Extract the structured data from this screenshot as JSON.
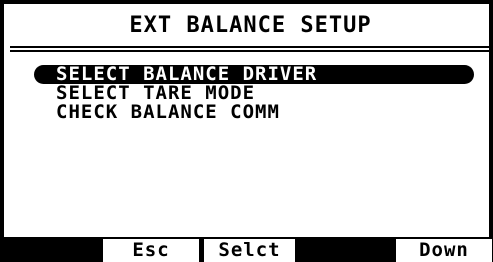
{
  "screen": {
    "title": "EXT BALANCE SETUP",
    "menu_items": [
      {
        "label": "SELECT BALANCE DRIVER",
        "selected": true
      },
      {
        "label": "SELECT TARE MODE",
        "selected": false
      },
      {
        "label": "CHECK BALANCE COMM",
        "selected": false
      }
    ]
  },
  "softkeys": {
    "f1": "",
    "f2": "Esc",
    "f3": "Selct",
    "f4": "",
    "f5": "Down"
  },
  "colors": {
    "background": "#ffffff",
    "foreground": "#000000"
  }
}
